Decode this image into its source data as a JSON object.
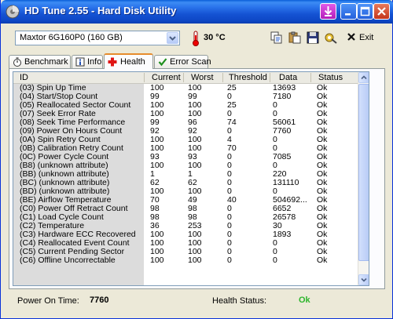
{
  "window": {
    "title": "HD Tune 2.55 - Hard Disk Utility"
  },
  "toolbar": {
    "drive_selected": "Maxtor 6G160P0 (160 GB)",
    "temperature": "30 °C",
    "exit_label": "Exit"
  },
  "tabs": [
    {
      "label": "Benchmark",
      "icon": "stopwatch-icon",
      "active": false
    },
    {
      "label": "Info",
      "icon": "info-icon",
      "active": false
    },
    {
      "label": "Health",
      "icon": "red-cross-icon",
      "active": true
    },
    {
      "label": "Error Scan",
      "icon": "checkmark-icon",
      "active": false
    }
  ],
  "grid": {
    "columns": [
      "ID",
      "Current",
      "Worst",
      "Threshold",
      "Data",
      "Status"
    ],
    "rows": [
      [
        "(03) Spin Up Time",
        "100",
        "100",
        "25",
        "13693",
        "Ok"
      ],
      [
        "(04) Start/Stop Count",
        "99",
        "99",
        "0",
        "7180",
        "Ok"
      ],
      [
        "(05) Reallocated Sector Count",
        "100",
        "100",
        "25",
        "0",
        "Ok"
      ],
      [
        "(07) Seek Error Rate",
        "100",
        "100",
        "0",
        "0",
        "Ok"
      ],
      [
        "(08) Seek Time Performance",
        "99",
        "96",
        "74",
        "56061",
        "Ok"
      ],
      [
        "(09) Power On Hours Count",
        "92",
        "92",
        "0",
        "7760",
        "Ok"
      ],
      [
        "(0A) Spin Retry Count",
        "100",
        "100",
        "4",
        "0",
        "Ok"
      ],
      [
        "(0B) Calibration Retry Count",
        "100",
        "100",
        "70",
        "0",
        "Ok"
      ],
      [
        "(0C) Power Cycle Count",
        "93",
        "93",
        "0",
        "7085",
        "Ok"
      ],
      [
        "(B8) (unknown attribute)",
        "100",
        "100",
        "0",
        "0",
        "Ok"
      ],
      [
        "(BB) (unknown attribute)",
        "1",
        "1",
        "0",
        "220",
        "Ok"
      ],
      [
        "(BC) (unknown attribute)",
        "62",
        "62",
        "0",
        "131110",
        "Ok"
      ],
      [
        "(BD) (unknown attribute)",
        "100",
        "100",
        "0",
        "0",
        "Ok"
      ],
      [
        "(BE) Airflow Temperature",
        "70",
        "49",
        "40",
        "504692...",
        "Ok"
      ],
      [
        "(C0) Power Off Retract Count",
        "98",
        "98",
        "0",
        "6652",
        "Ok"
      ],
      [
        "(C1) Load Cycle Count",
        "98",
        "98",
        "0",
        "26578",
        "Ok"
      ],
      [
        "(C2) Temperature",
        "36",
        "253",
        "0",
        "30",
        "Ok"
      ],
      [
        "(C3) Hardware ECC Recovered",
        "100",
        "100",
        "0",
        "1893",
        "Ok"
      ],
      [
        "(C4) Reallocated Event Count",
        "100",
        "100",
        "0",
        "0",
        "Ok"
      ],
      [
        "(C5) Current Pending Sector",
        "100",
        "100",
        "0",
        "0",
        "Ok"
      ],
      [
        "(C6) Offline Uncorrectable",
        "100",
        "100",
        "0",
        "0",
        "Ok"
      ]
    ]
  },
  "footer": {
    "power_on_label": "Power On Time:",
    "power_on_value": "7760",
    "health_label": "Health Status:",
    "health_value": "Ok"
  },
  "colors": {
    "health_ok": "#2CB52C",
    "title_bar": "#0A5FD8",
    "tab_highlight": "#E68B2C"
  }
}
